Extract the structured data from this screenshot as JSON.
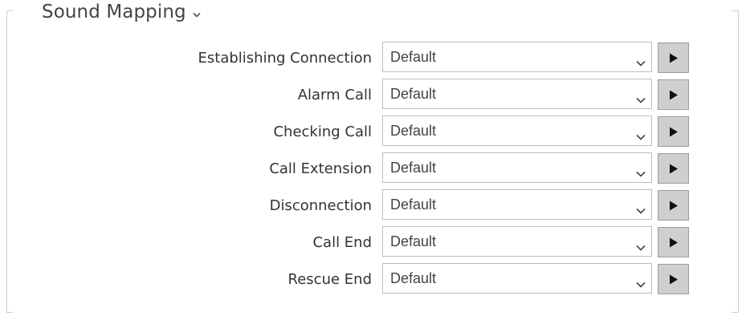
{
  "section": {
    "title": "Sound Mapping"
  },
  "rows": [
    {
      "label": "Establishing Connection",
      "value": "Default"
    },
    {
      "label": "Alarm Call",
      "value": "Default"
    },
    {
      "label": "Checking Call",
      "value": "Default"
    },
    {
      "label": "Call Extension",
      "value": "Default"
    },
    {
      "label": "Disconnection",
      "value": "Default"
    },
    {
      "label": "Call End",
      "value": "Default"
    },
    {
      "label": "Rescue End",
      "value": "Default"
    }
  ],
  "icons": {
    "collapse": "chevron-down-icon",
    "dropdown": "chevron-down-icon",
    "play": "play-icon"
  }
}
